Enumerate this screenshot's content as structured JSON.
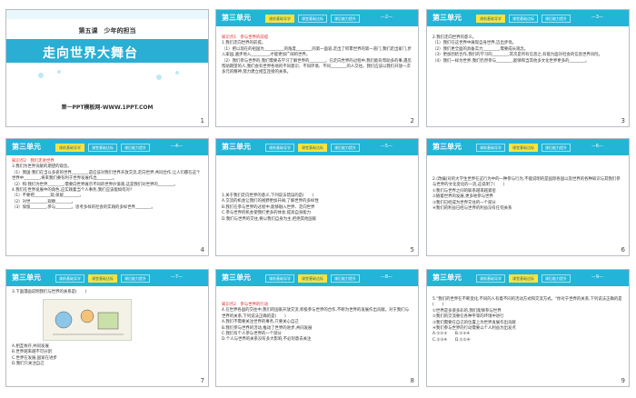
{
  "slides": {
    "s1": {
      "chapter": "第五课　少年的担当",
      "title": "走向世界大舞台",
      "source": "第一PPT模板网-WWW.1PPT.COM",
      "number": "1"
    },
    "header": {
      "unit": "第三单元",
      "tab1": "课前基础导学",
      "tab2": "课堂基础达标",
      "tab3": "课后能力提升"
    },
    "s2": {
      "pg": "—2—",
      "number": "2",
      "lines": [
        "知识点1　参与世界的前提",
        "1.我们走向世界的前提。",
        "（1）把以现在的祖国为__________的角度________的第一面容,走出了积累世界的第一道门,我们走出家门,步入家园,遍步地入_________,才能更加广阔的世界。",
        "（2）我们参与世界的,我们需要去学习了解世界的________。在走向世界的过程中,我们能有帮助多的事,遇见帮助期望的人,我们会有世界各地的不同意识、不同环境、不同________的人交往。我们应该以我们开放一次多元的精神,努力建立相互连接的关系。"
      ]
    },
    "s3": {
      "pg": "—3—",
      "number": "3",
      "lines": [
        "2.我们走向世界的意义。",
        "（1）我们在这世界中展现自身世界,迈出步伐。",
        "（2）我们更全面的具备实力________,需要成长观念。",
        "（3）更加团结合作,我们的学习的________,其次是所有信息之,有能力面对社会的信息世界风险。",
        "（4）我们一样为世界,我们仍然参与________,能够和当其他多文化世界更多的________。"
      ]
    },
    "s4": {
      "pg": "—4—",
      "number": "4",
      "lines": [
        "知识点2　我们走进世界",
        "3.我们为世界贡献的期望的观念。",
        "（1）我国:我们在当以多姿的世界________,是应该对我们世界开放交流,走向世界,共同合作,让人们都在这个世界中________,将来我们要有利于世界发展作出________。",
        "（2）和:我们为世界________,需要向世界展示不同的世界价值观,这是我们对世界的________。",
        "4.我们在世界发展中的角色,应实践着当个人事务,我们应该能如何对?",
        "（1）不要把________观,保留________。",
        "（2）对世________,观察________。",
        "（3）保留________,参与________。思考多样的社会的实践的多样世界________。"
      ]
    },
    "s5": {
      "pg": "—5—",
      "number": "5",
      "lines": [
        "1.关于我们走向世界的意义,下列说法错误的是(　　)",
        "A.交流的机会让我们的视野更加开阔,了解世界的多样性",
        "B.我们在参与世界的过程中,能够融入世界、走向世界",
        "C.参与世界的机会使我们更多的体会,提高自身能力",
        "D.我们与世界的交往,要以我们自身为主,拒绝其他国家"
      ]
    },
    "s6": {
      "pg": "—6—",
      "number": "6",
      "lines": [
        "2.(改编)对的大学生世界在这行为中的一种参与行为,不能说明的是国际各国以及世界的各种知识与其我们参与世界的文化变化的一流,这说明了(　　)",
        "①我们与世界之间的联系越来越紧密",
        "②随着世界的发展,更多地参与世界",
        "③我们已经成为世界交往的一个部分",
        "④我们的利益已经与世界的利益没有任何关系"
      ]
    },
    "s7": {
      "pg": "—7—",
      "number": "7",
      "question": "3.下面漫画说明我们与世界的关系是(　　)",
      "options": [
        "A.相互依存,共同发展",
        "B.世界越来越不可分割",
        "C.世界在发展,国家在进步",
        "D.我们只关注自己"
      ]
    },
    "s8": {
      "pg": "—8—",
      "number": "8",
      "lines": [
        "知识点2　参与世界的行动",
        "4.在世界各国的交往中,我们的国家开放交流,积极参与世界的合作,不断为世界的发展作出贡献。对于我们与世界的关系,下列说法正确的是(　　)",
        "A.我们不需要关注世界的事务,只要关心自己",
        "B.我们参与世界的活动,推动了世界的进步,共同发展",
        "C.我们有个人参与世界的一个部分",
        "D.个人与世界的关系没有多大影响,不必刻意去关注"
      ]
    },
    "s9": {
      "pg": "—9—",
      "number": "9",
      "lines": [
        "5.\"我们的世界在不断变化,不同的人有着不同的活动方式和交流方式。\"你对于世界的关系,下列说法正确的是(　　)",
        "①世界是多姿多彩的,我们能够参与世界",
        "②我们的交流要在各种平等的环境中进行",
        "③我们需要在自己的位置上为世界发展作出贡献",
        "④我们参与世界的行动需要以个人利益为出发点",
        "A.①②③　　B.①③④",
        "C.②③④　　D.①②④"
      ]
    }
  }
}
